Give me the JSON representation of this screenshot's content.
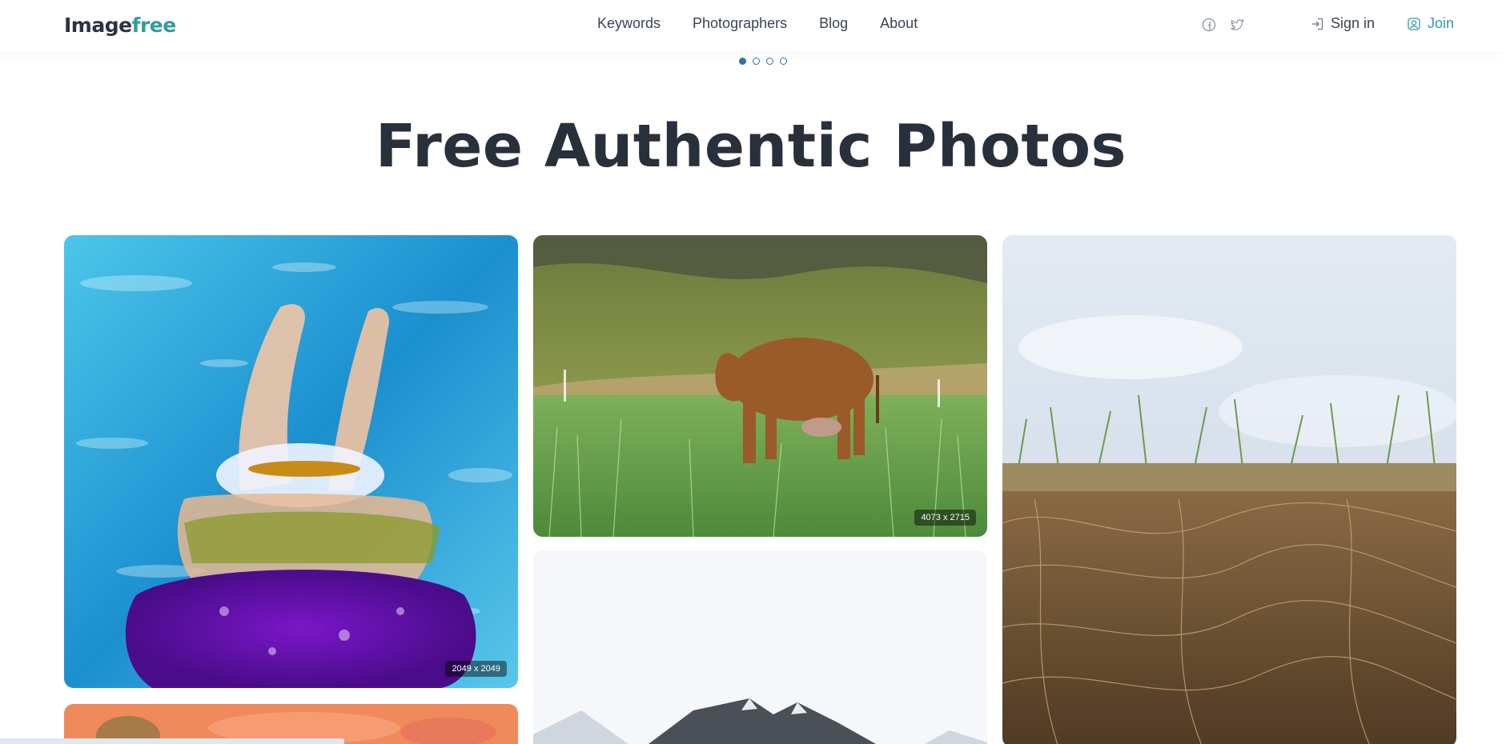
{
  "header": {
    "logo_part1": "Im",
    "logo_part2": "age",
    "logo_part3": "free",
    "nav": [
      "Keywords",
      "Photographers",
      "Blog",
      "About"
    ],
    "social_icons": [
      "facebook-icon",
      "twitter-icon"
    ],
    "sign_in_label": "Sign in",
    "join_label": "Join"
  },
  "carousel": {
    "dots": 4,
    "active_index": 0
  },
  "hero": {
    "title": "Free Authentic Photos"
  },
  "photos": [
    {
      "subject": "swimmer",
      "dimensions": "2049 x 2049"
    },
    {
      "subject": "cow",
      "dimensions": "4073 x 2715"
    },
    {
      "subject": "grass-soil",
      "dimensions": ""
    },
    {
      "subject": "flower",
      "dimensions": ""
    },
    {
      "subject": "mountain",
      "dimensions": ""
    }
  ],
  "colors": {
    "accent": "#2f9c9f",
    "title": "#27303b",
    "dot": "#2a73a8"
  }
}
